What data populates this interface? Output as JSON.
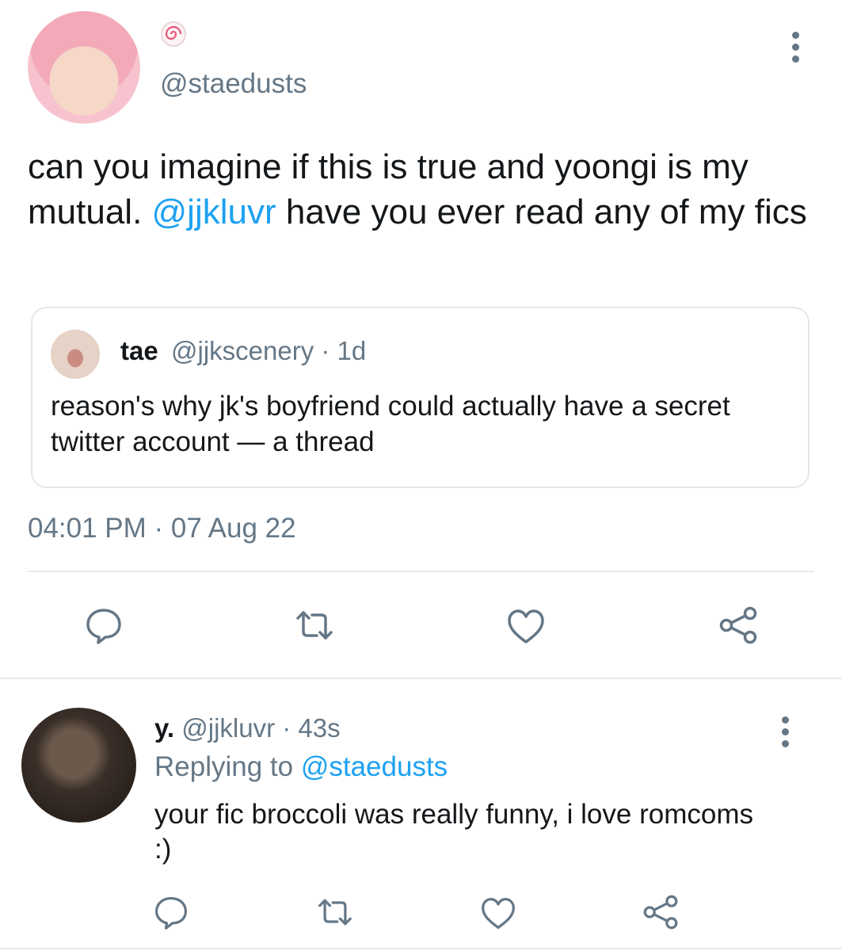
{
  "tweet": {
    "handle": "@staedusts",
    "text_before": "can you imagine if this is true and yoongi is my mutual. ",
    "mention": "@jjkluvr",
    "text_after": " have you ever read any of my fics",
    "timestamp": "04:01 PM · 07 Aug 22",
    "badge_icon": "fishcake-emoji-icon"
  },
  "quote": {
    "name": "tae",
    "handle_time": "@jjkscenery · 1d",
    "text": "reason's why jk's boyfriend could actually have a secret twitter account — a thread"
  },
  "reply": {
    "name": "y.",
    "handle_time": " @jjkluvr · 43s",
    "replying_prefix": "Replying to ",
    "replying_to": "@staedusts",
    "text": "your fic broccoli was really funny, i love romcoms :)"
  },
  "colors": {
    "icon_gray": "#657786",
    "link_blue": "#1da1f2",
    "divider": "#e6ecf0"
  }
}
